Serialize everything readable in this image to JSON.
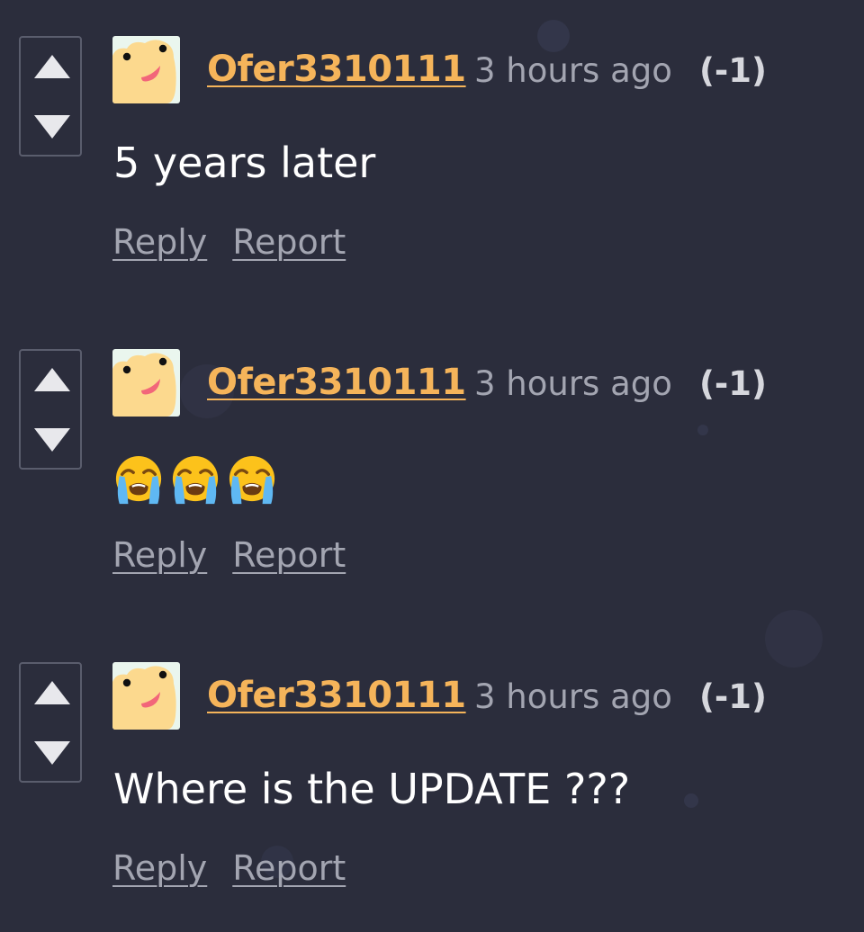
{
  "colors": {
    "background": "#2b2d3c",
    "username": "#f5b45a",
    "timestamp": "#a3a5b1",
    "score": "#d6d7dd",
    "body": "#ffffff",
    "action_links": "#a3a5b1",
    "vote_border": "#5a5d6d",
    "vote_arrow": "#e8e8ec"
  },
  "comments": [
    {
      "author": "Ofer3310111",
      "timestamp": "3 hours ago",
      "score": "(-1)",
      "text": "5 years later",
      "avatar_icon": "frog-face-avatar-icon",
      "vote_up_icon": "triangle-up-icon",
      "vote_down_icon": "triangle-down-icon",
      "reply_label": "Reply",
      "report_label": "Report"
    },
    {
      "author": "Ofer3310111",
      "timestamp": "3 hours ago",
      "score": "(-1)",
      "text": "😭😭😭",
      "emoji_icons": [
        "loudly-crying-face-icon",
        "loudly-crying-face-icon",
        "loudly-crying-face-icon"
      ],
      "avatar_icon": "frog-face-avatar-icon",
      "vote_up_icon": "triangle-up-icon",
      "vote_down_icon": "triangle-down-icon",
      "reply_label": "Reply",
      "report_label": "Report"
    },
    {
      "author": "Ofer3310111",
      "timestamp": "3 hours ago",
      "score": "(-1)",
      "text": "Where is the UPDATE ???",
      "avatar_icon": "frog-face-avatar-icon",
      "vote_up_icon": "triangle-up-icon",
      "vote_down_icon": "triangle-down-icon",
      "reply_label": "Reply",
      "report_label": "Report"
    }
  ]
}
